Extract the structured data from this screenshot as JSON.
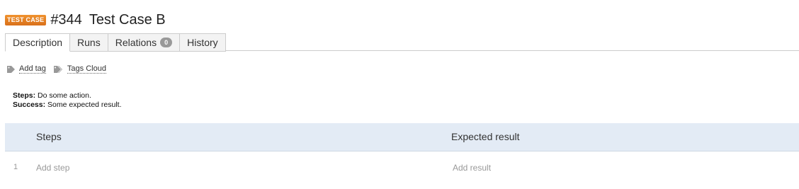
{
  "header": {
    "type_badge": "TEST CASE",
    "case_id": "#344",
    "title": "Test Case B",
    "badge_color": "#e67e22"
  },
  "tabs": [
    {
      "label": "Description",
      "active": true
    },
    {
      "label": "Runs",
      "active": false
    },
    {
      "label": "Relations",
      "count": "0",
      "active": false
    },
    {
      "label": "History",
      "active": false
    }
  ],
  "tags": {
    "add_tag": "Add tag",
    "tags_cloud": "Tags Cloud",
    "icon": "tag-icon"
  },
  "description": {
    "steps_label": "Steps:",
    "steps_text": "Do some action.",
    "success_label": "Success:",
    "success_text": "Some expected result."
  },
  "steps_table": {
    "header_steps": "Steps",
    "header_expected": "Expected result",
    "header_bg": "#e3ebf5",
    "rows": [
      {
        "num": "1",
        "step_placeholder": "Add step",
        "result_placeholder": "Add result"
      }
    ]
  }
}
